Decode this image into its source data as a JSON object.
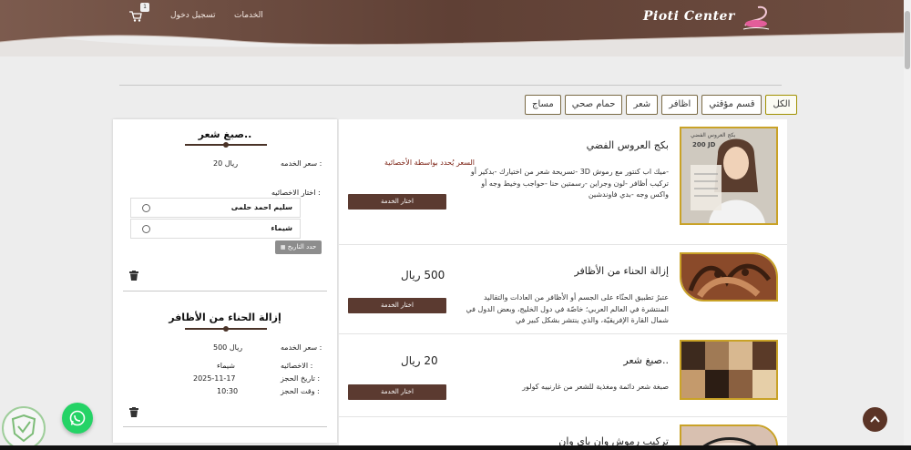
{
  "header": {
    "brand": "Pioti Center",
    "nav": {
      "services": "الخدمات",
      "login": "تسجيل دخول"
    },
    "cart_count": "1"
  },
  "tabs": [
    {
      "label": "الكل",
      "active": true
    },
    {
      "label": "قسم مؤقتي",
      "active": false
    },
    {
      "label": "اظافر",
      "active": false
    },
    {
      "label": "شعر",
      "active": false
    },
    {
      "label": "حمام صحي",
      "active": false
    },
    {
      "label": "مساج",
      "active": false
    }
  ],
  "services": [
    {
      "title": "بكج العروس الفضي",
      "description": "-ميك اب كنتور مع رموش 3D -تسريحة شعر من اختيارك -بدكير أو تركيب أظافر -لون وجراين -رسمتين حنا -حواجب وخيط وجه أو واكس وجه -بدي فاوندشين",
      "price": "",
      "note": "السعر يُحدد بواسطة الأخصائية",
      "button": "اختار الخدمة",
      "image_badge": "200 JD",
      "image_caption": "بكج العروس الفضي"
    },
    {
      "title": "إزالة الحناء من الأظافر",
      "description": "عتبرُ تطبيق الحنّاء على الجسم أو الأظافر من العادات والتقاليد المنتشرة في العالم العربي؛ خاصّة في دول الخليج، وبعض الدول في شمال القارة الإفريقيّة، والذي ينتشر بشكل كبير في",
      "price": "500 ريال",
      "note": "",
      "button": "اختار الخدمة"
    },
    {
      "title": "صبغ شعر..",
      "description": "صبغة شعر دائمة ومغذية للشعر من غارنييه كولور",
      "price": "20 ريال",
      "note": "",
      "button": "اختار الخدمة"
    },
    {
      "title": "تركيب رموش وان باي وان",
      "description": "",
      "price": "",
      "note": "",
      "button": ""
    }
  ],
  "cart": {
    "items": [
      {
        "title": "صبغ شعر..",
        "price_label": "سعر الخدمه :",
        "price": "20 ريال",
        "choose_specialist_label": "اختار الاخصائيه :",
        "specialists": [
          "سليم احمد حلمى",
          "شيماء"
        ],
        "date_button": "حدد التاريخ"
      },
      {
        "title": "إزالة الحناء من الأظافر",
        "price_label": "سعر الخدمه :",
        "price": "500 ريال",
        "specialist_label": "الاخصائيه :",
        "specialist": "شيماء",
        "date_label": "تاريخ الحجز :",
        "date": "2025-11-17",
        "time_label": "وقت الحجز :",
        "time": "10:30"
      }
    ]
  },
  "colors": {
    "header": "#6b4a3e",
    "button": "#5b3a30",
    "tab_border": "#7a6a45",
    "whatsapp": "#25d366"
  }
}
